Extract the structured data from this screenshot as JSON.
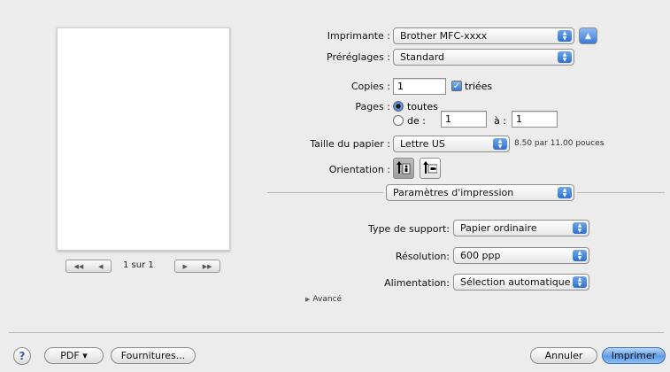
{
  "preview": {
    "page_label": "1 sur 1",
    "first_icon": "first-page-icon",
    "prev_icon": "previous-page-icon",
    "next_icon": "next-page-icon",
    "last_icon": "last-page-icon"
  },
  "printer": {
    "label": "Imprimante :",
    "value": "Brother MFC-xxxx",
    "collapse_icon": "triangle-up-icon"
  },
  "presets": {
    "label": "Préréglages :",
    "value": "Standard"
  },
  "copies": {
    "label": "Copies :",
    "value": "1",
    "collated_label": "triées",
    "collated_checked": true
  },
  "pages": {
    "label": "Pages :",
    "all_label": "toutes",
    "from_label": "de :",
    "from_value": "1",
    "to_label": "à :",
    "to_value": "1",
    "selected": "all"
  },
  "paper_size": {
    "label": "Taille du papier :",
    "value": "Lettre US",
    "dimensions": "8.50 par 11.00 pouces"
  },
  "orientation": {
    "label": "Orientation :",
    "portrait_icon": "portrait-orientation-icon",
    "landscape_icon": "landscape-orientation-icon",
    "selected": "portrait"
  },
  "section": {
    "value": "Paramètres d'impression"
  },
  "media_type": {
    "label": "Type de support:",
    "value": "Papier ordinaire"
  },
  "resolution": {
    "label": "Résolution:",
    "value": "600 ppp"
  },
  "paper_source": {
    "label": "Alimentation:",
    "value": "Sélection automatique"
  },
  "advanced": {
    "label": "Avancé",
    "icon": "disclosure-triangle-icon"
  },
  "footer": {
    "help_label": "?",
    "pdf_label": "PDF ▾",
    "supplies_label": "Fournitures...",
    "cancel_label": "Annuler",
    "print_label": "Imprimer"
  },
  "colors": {
    "accent": "#3a7bd8",
    "background": "#ececec"
  }
}
